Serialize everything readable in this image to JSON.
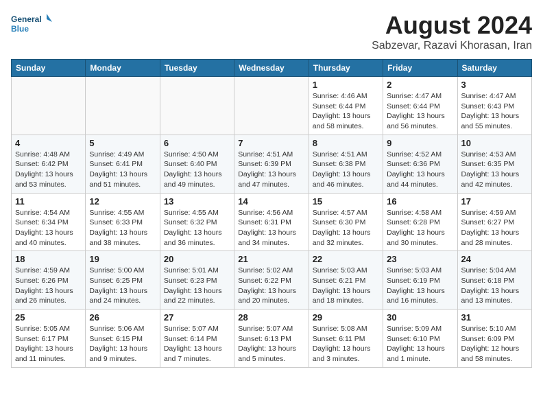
{
  "header": {
    "logo_line1": "General",
    "logo_line2": "Blue",
    "month_year": "August 2024",
    "location": "Sabzevar, Razavi Khorasan, Iran"
  },
  "days_of_week": [
    "Sunday",
    "Monday",
    "Tuesday",
    "Wednesday",
    "Thursday",
    "Friday",
    "Saturday"
  ],
  "weeks": [
    [
      {
        "day": "",
        "info": ""
      },
      {
        "day": "",
        "info": ""
      },
      {
        "day": "",
        "info": ""
      },
      {
        "day": "",
        "info": ""
      },
      {
        "day": "1",
        "info": "Sunrise: 4:46 AM\nSunset: 6:44 PM\nDaylight: 13 hours\nand 58 minutes."
      },
      {
        "day": "2",
        "info": "Sunrise: 4:47 AM\nSunset: 6:44 PM\nDaylight: 13 hours\nand 56 minutes."
      },
      {
        "day": "3",
        "info": "Sunrise: 4:47 AM\nSunset: 6:43 PM\nDaylight: 13 hours\nand 55 minutes."
      }
    ],
    [
      {
        "day": "4",
        "info": "Sunrise: 4:48 AM\nSunset: 6:42 PM\nDaylight: 13 hours\nand 53 minutes."
      },
      {
        "day": "5",
        "info": "Sunrise: 4:49 AM\nSunset: 6:41 PM\nDaylight: 13 hours\nand 51 minutes."
      },
      {
        "day": "6",
        "info": "Sunrise: 4:50 AM\nSunset: 6:40 PM\nDaylight: 13 hours\nand 49 minutes."
      },
      {
        "day": "7",
        "info": "Sunrise: 4:51 AM\nSunset: 6:39 PM\nDaylight: 13 hours\nand 47 minutes."
      },
      {
        "day": "8",
        "info": "Sunrise: 4:51 AM\nSunset: 6:38 PM\nDaylight: 13 hours\nand 46 minutes."
      },
      {
        "day": "9",
        "info": "Sunrise: 4:52 AM\nSunset: 6:36 PM\nDaylight: 13 hours\nand 44 minutes."
      },
      {
        "day": "10",
        "info": "Sunrise: 4:53 AM\nSunset: 6:35 PM\nDaylight: 13 hours\nand 42 minutes."
      }
    ],
    [
      {
        "day": "11",
        "info": "Sunrise: 4:54 AM\nSunset: 6:34 PM\nDaylight: 13 hours\nand 40 minutes."
      },
      {
        "day": "12",
        "info": "Sunrise: 4:55 AM\nSunset: 6:33 PM\nDaylight: 13 hours\nand 38 minutes."
      },
      {
        "day": "13",
        "info": "Sunrise: 4:55 AM\nSunset: 6:32 PM\nDaylight: 13 hours\nand 36 minutes."
      },
      {
        "day": "14",
        "info": "Sunrise: 4:56 AM\nSunset: 6:31 PM\nDaylight: 13 hours\nand 34 minutes."
      },
      {
        "day": "15",
        "info": "Sunrise: 4:57 AM\nSunset: 6:30 PM\nDaylight: 13 hours\nand 32 minutes."
      },
      {
        "day": "16",
        "info": "Sunrise: 4:58 AM\nSunset: 6:28 PM\nDaylight: 13 hours\nand 30 minutes."
      },
      {
        "day": "17",
        "info": "Sunrise: 4:59 AM\nSunset: 6:27 PM\nDaylight: 13 hours\nand 28 minutes."
      }
    ],
    [
      {
        "day": "18",
        "info": "Sunrise: 4:59 AM\nSunset: 6:26 PM\nDaylight: 13 hours\nand 26 minutes."
      },
      {
        "day": "19",
        "info": "Sunrise: 5:00 AM\nSunset: 6:25 PM\nDaylight: 13 hours\nand 24 minutes."
      },
      {
        "day": "20",
        "info": "Sunrise: 5:01 AM\nSunset: 6:23 PM\nDaylight: 13 hours\nand 22 minutes."
      },
      {
        "day": "21",
        "info": "Sunrise: 5:02 AM\nSunset: 6:22 PM\nDaylight: 13 hours\nand 20 minutes."
      },
      {
        "day": "22",
        "info": "Sunrise: 5:03 AM\nSunset: 6:21 PM\nDaylight: 13 hours\nand 18 minutes."
      },
      {
        "day": "23",
        "info": "Sunrise: 5:03 AM\nSunset: 6:19 PM\nDaylight: 13 hours\nand 16 minutes."
      },
      {
        "day": "24",
        "info": "Sunrise: 5:04 AM\nSunset: 6:18 PM\nDaylight: 13 hours\nand 13 minutes."
      }
    ],
    [
      {
        "day": "25",
        "info": "Sunrise: 5:05 AM\nSunset: 6:17 PM\nDaylight: 13 hours\nand 11 minutes."
      },
      {
        "day": "26",
        "info": "Sunrise: 5:06 AM\nSunset: 6:15 PM\nDaylight: 13 hours\nand 9 minutes."
      },
      {
        "day": "27",
        "info": "Sunrise: 5:07 AM\nSunset: 6:14 PM\nDaylight: 13 hours\nand 7 minutes."
      },
      {
        "day": "28",
        "info": "Sunrise: 5:07 AM\nSunset: 6:13 PM\nDaylight: 13 hours\nand 5 minutes."
      },
      {
        "day": "29",
        "info": "Sunrise: 5:08 AM\nSunset: 6:11 PM\nDaylight: 13 hours\nand 3 minutes."
      },
      {
        "day": "30",
        "info": "Sunrise: 5:09 AM\nSunset: 6:10 PM\nDaylight: 13 hours\nand 1 minute."
      },
      {
        "day": "31",
        "info": "Sunrise: 5:10 AM\nSunset: 6:09 PM\nDaylight: 12 hours\nand 58 minutes."
      }
    ]
  ]
}
